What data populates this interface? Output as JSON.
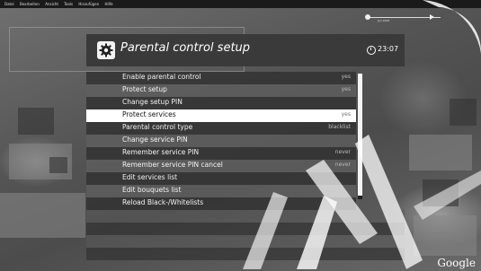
{
  "app": {
    "menu": [
      "Datei",
      "Bearbeiten",
      "Ansicht",
      "Tools",
      "Hinzufügen",
      "Hilfe"
    ]
  },
  "timeline": {
    "date": "Jan 2008"
  },
  "dialog": {
    "title": "Parental control setup",
    "time": "23:07",
    "icon": "gear-icon",
    "selected_index": 3,
    "items": [
      {
        "label": "Enable parental control",
        "value": "yes"
      },
      {
        "label": "Protect setup",
        "value": "yes"
      },
      {
        "label": "Change setup PIN",
        "value": ""
      },
      {
        "label": "Protect services",
        "value": "yes"
      },
      {
        "label": "Parental control type",
        "value": "blacklist"
      },
      {
        "label": "Change service PIN",
        "value": ""
      },
      {
        "label": "Remember service PIN",
        "value": "never"
      },
      {
        "label": "Remember service PIN cancel",
        "value": "never"
      },
      {
        "label": "Edit services list",
        "value": ""
      },
      {
        "label": "Edit bouquets list",
        "value": ""
      },
      {
        "label": "Reload Black-/Whitelists",
        "value": ""
      }
    ]
  },
  "branding": {
    "logo": "Google"
  },
  "colors": {
    "highlight": "#ffffff",
    "row_dark": "#323232",
    "row_light": "#5f5f5f"
  }
}
